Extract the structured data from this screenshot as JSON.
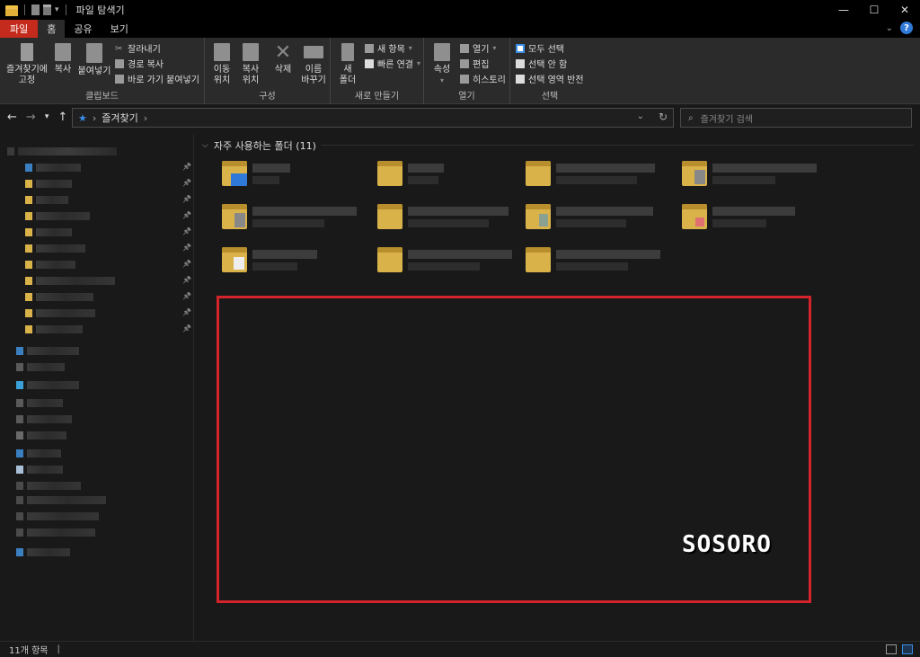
{
  "window": {
    "title": "파일 탐색기",
    "controls": {
      "minimize": "—",
      "maximize": "☐",
      "close": "✕"
    }
  },
  "tabs": [
    {
      "label": "파일"
    },
    {
      "label": "홈"
    },
    {
      "label": "공유"
    },
    {
      "label": "보기"
    }
  ],
  "ribbon": {
    "clipboard": {
      "pin": "즐겨찾기에\n고정",
      "copy": "복사",
      "paste": "붙여넣기",
      "cut": "잘라내기",
      "copy_path": "경로 복사",
      "paste_shortcut": "바로 가기 붙여넣기",
      "label": "클립보드"
    },
    "organize": {
      "move_to": "이동\n위치",
      "copy_to": "복사\n위치",
      "delete": "삭제",
      "rename": "이름\n바꾸기",
      "label": "구성"
    },
    "new": {
      "new_folder": "새\n폴더",
      "new_item": "새 항목",
      "easy_access": "빠른 연결",
      "label": "새로 만들기"
    },
    "open": {
      "properties": "속성",
      "open": "열기",
      "edit": "편집",
      "history": "히스토리",
      "label": "열기"
    },
    "select": {
      "select_all": "모두 선택",
      "select_none": "선택 안 함",
      "invert": "선택 영역 반전",
      "label": "선택"
    }
  },
  "address": {
    "path": "즐겨찾기",
    "search_placeholder": "즐겨찾기 검색"
  },
  "content": {
    "section_title": "자주 사용하는 폴더 (11)"
  },
  "watermark": "SOSORO",
  "status": {
    "item_count": "11개 항목"
  }
}
